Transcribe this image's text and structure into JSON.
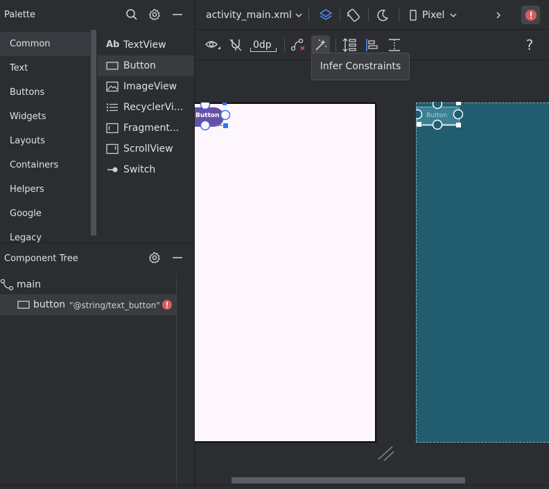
{
  "palette": {
    "title": "Palette",
    "categories": [
      "Common",
      "Text",
      "Buttons",
      "Widgets",
      "Layouts",
      "Containers",
      "Helpers",
      "Google",
      "Legacy"
    ],
    "selected_category": "Common",
    "widgets": [
      {
        "label": "TextView",
        "icon": "textview-icon",
        "icon_text": "Ab"
      },
      {
        "label": "Button",
        "icon": "button-icon"
      },
      {
        "label": "ImageView",
        "icon": "imageview-icon"
      },
      {
        "label": "RecyclerVi...",
        "icon": "recyclerview-icon"
      },
      {
        "label": "Fragment...",
        "icon": "fragment-icon"
      },
      {
        "label": "ScrollView",
        "icon": "scrollview-icon"
      },
      {
        "label": "Switch",
        "icon": "switch-icon"
      }
    ],
    "selected_widget": "Button"
  },
  "component_tree": {
    "title": "Component Tree",
    "root": "main",
    "child_type": "button",
    "child_text": "\"@string/text_button\""
  },
  "toolbar": {
    "file_name": "activity_main.xml",
    "device": "Pixel",
    "margin_value": "0dp"
  },
  "tooltip": "Infer Constraints",
  "design": {
    "button_label": "Button",
    "blueprint_button_label": "Button"
  },
  "colors": {
    "accent": "#3574f0",
    "error": "#db5c5c",
    "blueprint": "#225c6f",
    "button_purple": "#6750a4"
  }
}
